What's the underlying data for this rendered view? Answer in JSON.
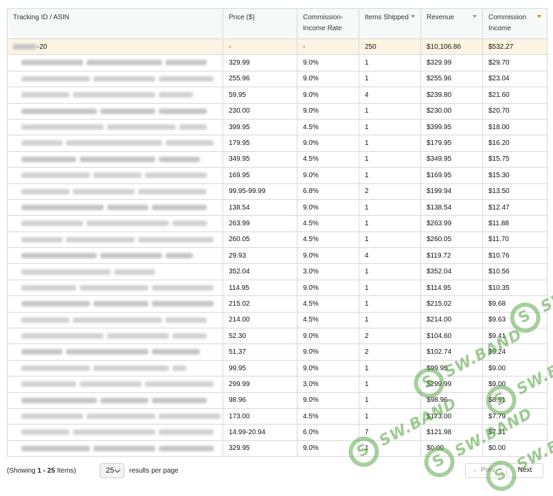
{
  "table": {
    "headers": [
      {
        "label": "Tracking ID / ASIN",
        "sort": ""
      },
      {
        "label": "Price ($)",
        "sort": ""
      },
      {
        "label": "Commission-Income Rate",
        "sort": ""
      },
      {
        "label": "Items Shipped",
        "sort": "sortable"
      },
      {
        "label": "Revenue",
        "sort": "sortable"
      },
      {
        "label": "Commission Income",
        "sort": "active"
      }
    ],
    "summary": {
      "tracking_id": "-20",
      "price": "-",
      "rate": "-",
      "items": "250",
      "revenue": "$10,106.86",
      "income": "$532.27"
    },
    "rows": [
      {
        "price": "329.99",
        "rate": "9.0%",
        "items": "1",
        "revenue": "$329.99",
        "income": "$29.70"
      },
      {
        "price": "255.96",
        "rate": "9.0%",
        "items": "1",
        "revenue": "$255.96",
        "income": "$23.04"
      },
      {
        "price": "59.95",
        "rate": "9.0%",
        "items": "4",
        "revenue": "$239.80",
        "income": "$21.60"
      },
      {
        "price": "230.00",
        "rate": "9.0%",
        "items": "1",
        "revenue": "$230.00",
        "income": "$20.70"
      },
      {
        "price": "399.95",
        "rate": "4.5%",
        "items": "1",
        "revenue": "$399.95",
        "income": "$18.00"
      },
      {
        "price": "179.95",
        "rate": "9.0%",
        "items": "1",
        "revenue": "$179.95",
        "income": "$16.20"
      },
      {
        "price": "349.95",
        "rate": "4.5%",
        "items": "1",
        "revenue": "$349.95",
        "income": "$15.75"
      },
      {
        "price": "169.95",
        "rate": "9.0%",
        "items": "1",
        "revenue": "$169.95",
        "income": "$15.30"
      },
      {
        "price": "99.95-99.99",
        "rate": "6.8%",
        "items": "2",
        "revenue": "$199.94",
        "income": "$13.50"
      },
      {
        "price": "138.54",
        "rate": "9.0%",
        "items": "1",
        "revenue": "$138.54",
        "income": "$12.47"
      },
      {
        "price": "263.99",
        "rate": "4.5%",
        "items": "1",
        "revenue": "$263.99",
        "income": "$11.88"
      },
      {
        "price": "260.05",
        "rate": "4.5%",
        "items": "1",
        "revenue": "$260.05",
        "income": "$11.70"
      },
      {
        "price": "29.93",
        "rate": "9.0%",
        "items": "4",
        "revenue": "$119.72",
        "income": "$10.76"
      },
      {
        "price": "352.04",
        "rate": "3.0%",
        "items": "1",
        "revenue": "$352.04",
        "income": "$10.56"
      },
      {
        "price": "114.95",
        "rate": "9.0%",
        "items": "1",
        "revenue": "$114.95",
        "income": "$10.35"
      },
      {
        "price": "215.02",
        "rate": "4.5%",
        "items": "1",
        "revenue": "$215.02",
        "income": "$9.68"
      },
      {
        "price": "214.00",
        "rate": "4.5%",
        "items": "1",
        "revenue": "$214.00",
        "income": "$9.63"
      },
      {
        "price": "52.30",
        "rate": "9.0%",
        "items": "2",
        "revenue": "$104.60",
        "income": "$9.41"
      },
      {
        "price": "51.37",
        "rate": "9.0%",
        "items": "2",
        "revenue": "$102.74",
        "income": "$9.24"
      },
      {
        "price": "99.95",
        "rate": "9.0%",
        "items": "1",
        "revenue": "$99.95",
        "income": "$9.00"
      },
      {
        "price": "299.99",
        "rate": "3.0%",
        "items": "1",
        "revenue": "$299.99",
        "income": "$9.00"
      },
      {
        "price": "98.96",
        "rate": "9.0%",
        "items": "1",
        "revenue": "$98.96",
        "income": "$8.91"
      },
      {
        "price": "173.00",
        "rate": "4.5%",
        "items": "1",
        "revenue": "$173.00",
        "income": "$7.79"
      },
      {
        "price": "14.99-20.94",
        "rate": "6.0%",
        "items": "7",
        "revenue": "$121.98",
        "income": "$7.31"
      },
      {
        "price": "329.95",
        "rate": "9.0%",
        "items": "1",
        "revenue": "$0.00",
        "income": "$0.00"
      }
    ]
  },
  "footer": {
    "showing_prefix": "(Showing ",
    "showing_range": "1 - 25",
    "showing_suffix": " Items)",
    "per_page_value": "25",
    "per_page_label": "results per page",
    "prev_label": "← Prev",
    "next_label": "Next"
  },
  "watermark": {
    "text": "SW.BAND",
    "color": "#50a03c"
  }
}
